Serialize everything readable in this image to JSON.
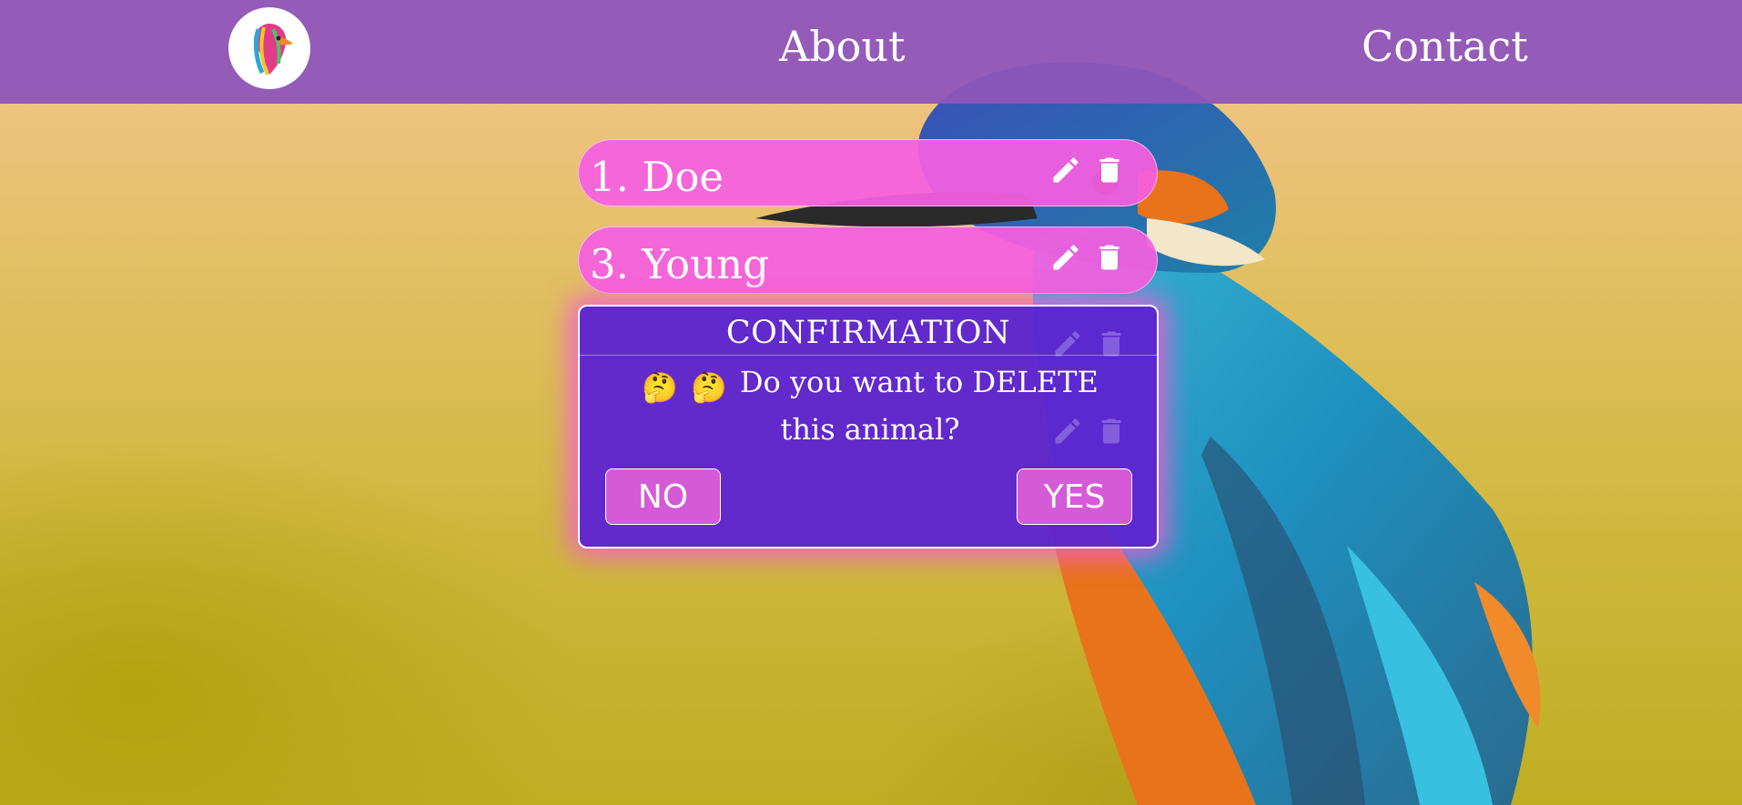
{
  "nav": {
    "logo_icon": "colorful-bird-logo-icon",
    "links": [
      "About",
      "Contact"
    ]
  },
  "animals": [
    {
      "label": "1. Doe",
      "edit_icon": "pencil-icon",
      "delete_icon": "trash-icon"
    },
    {
      "label": "3. Young",
      "edit_icon": "pencil-icon",
      "delete_icon": "trash-icon"
    }
  ],
  "modal": {
    "title": "CONFIRMATION",
    "emoji": "🤔",
    "message_line1": "Do you want to DELETE",
    "message_line2": "this animal?",
    "no_label": "NO",
    "yes_label": "YES"
  },
  "colors": {
    "navbar": "#8e56ba",
    "item_bg": "#f55fe1",
    "modal_bg": "#5e24d0",
    "button_bg": "#d55ad8",
    "text": "#ffffff"
  }
}
